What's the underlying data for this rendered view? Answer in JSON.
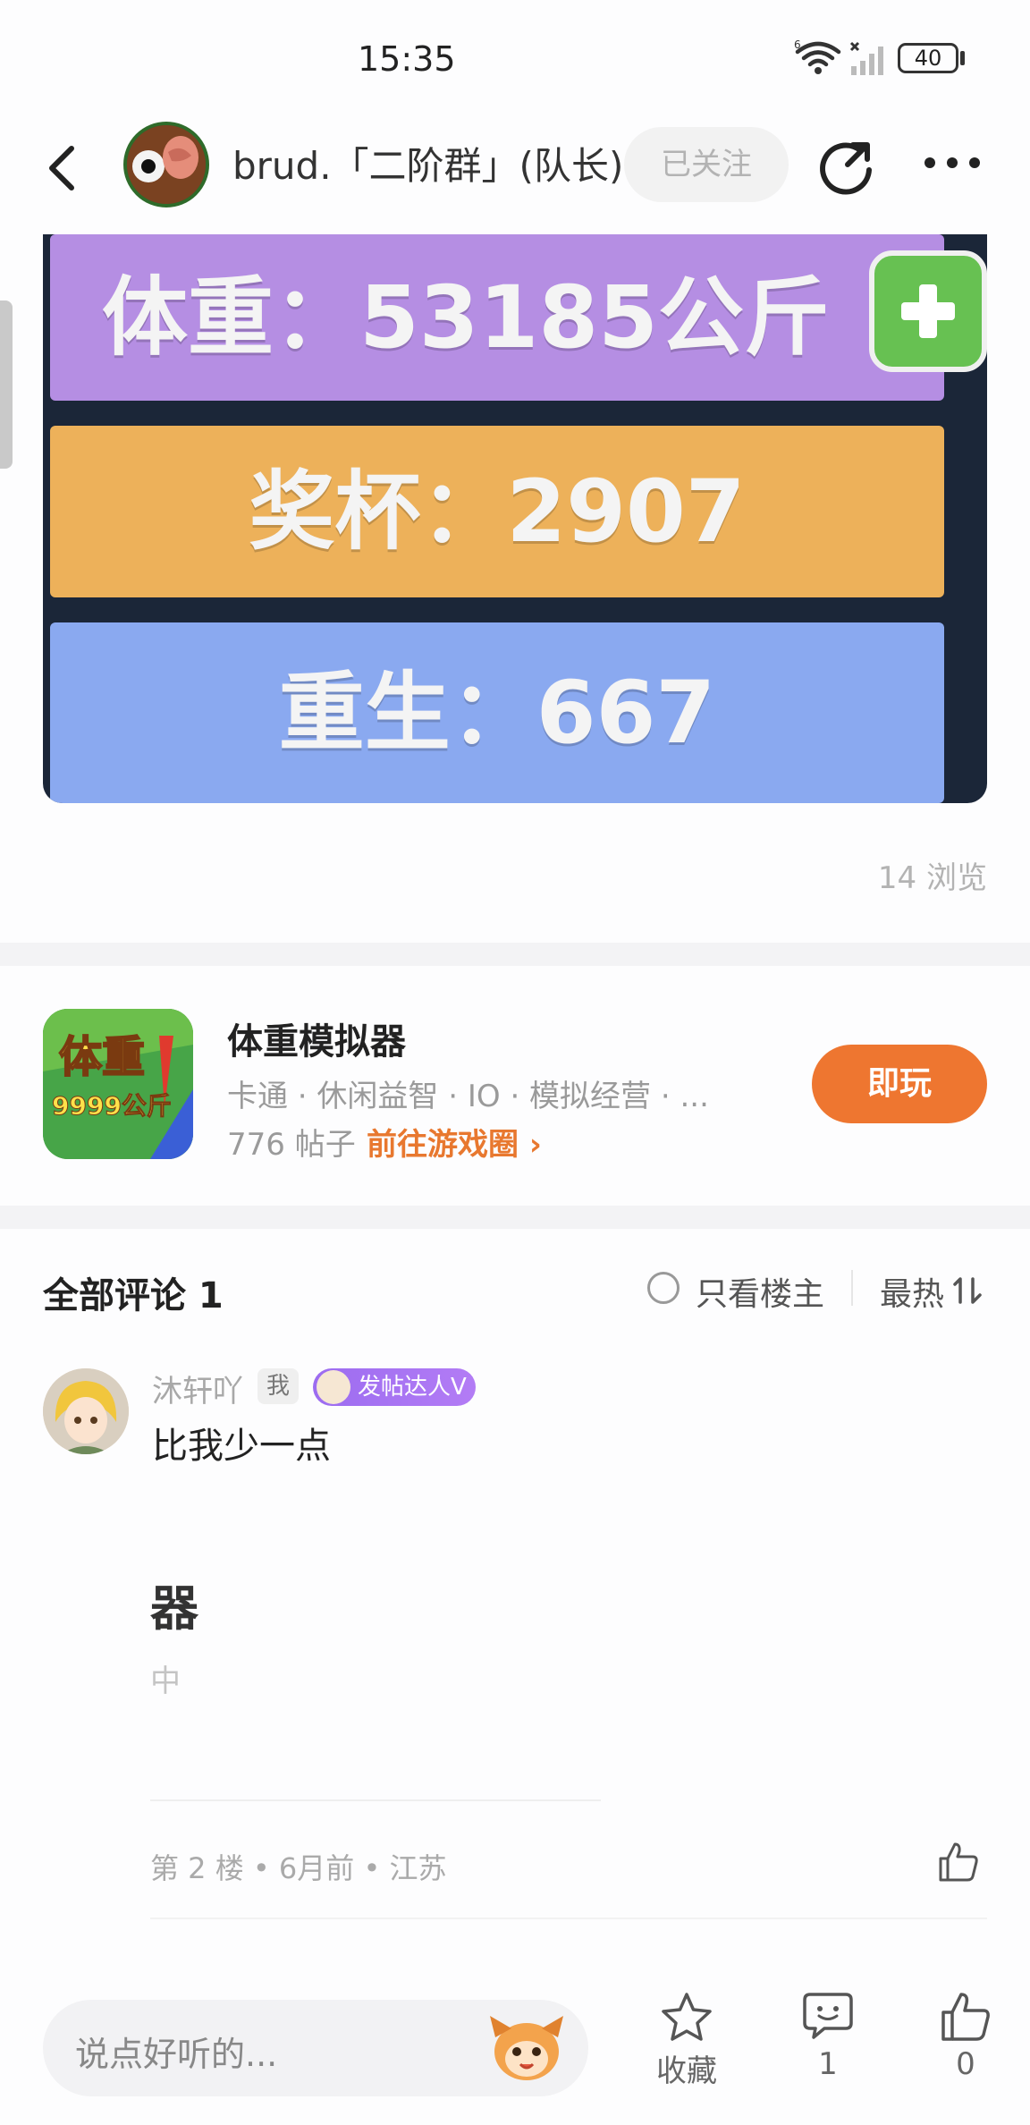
{
  "status_bar": {
    "time": "15:35",
    "battery": "40"
  },
  "header": {
    "username": "brud.「二阶群」(队长)",
    "follow_label": "已关注"
  },
  "post": {
    "image": {
      "weight_text": "体重：53185公斤",
      "trophy_text": "奖杯：2907",
      "rebirth_text": "重生：667"
    },
    "views": "14 浏览"
  },
  "game_card": {
    "icon_text_top": "体重",
    "icon_text_bottom": "9999公斤",
    "name": "体重模拟器",
    "tags": "卡通 · 休闲益智 · IO · 模拟经营 · ...",
    "posts": "776 帖子",
    "link_label": "前往游戏圈 ›",
    "play_label": "即玩"
  },
  "comments": {
    "title": "全部评论 1",
    "only_op_label": "只看楼主",
    "sort_label": "最热",
    "items": [
      {
        "username": "沐轩吖",
        "me_tag": "我",
        "badge": "发帖达人V",
        "text": "比我少一点",
        "embed_title": "器",
        "embed_sub": "中",
        "meta": "第 2 楼 • 6月前 • 江苏"
      }
    ]
  },
  "bottom_bar": {
    "input_placeholder": "说点好听的...",
    "favorite_label": "收藏",
    "comment_count": "1",
    "like_count": "0"
  },
  "colors": {
    "accent_orange": "#ee7630",
    "badge_purple": "#a774f2",
    "muted_text": "#a8a8a8"
  }
}
